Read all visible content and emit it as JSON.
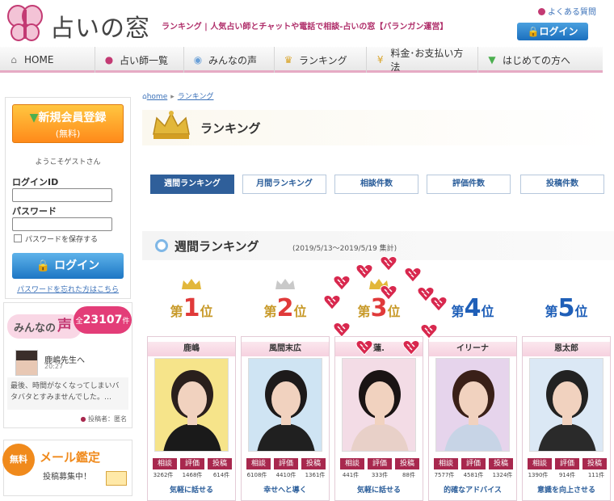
{
  "header": {
    "logo_text": "占いの窓",
    "tagline": "ランキング | 人気占い師とチャットや電話で相談-占いの窓【バランガン運営】",
    "faq": "よくある質問",
    "login": "ログイン"
  },
  "nav": [
    {
      "label": "HOME",
      "icon": "home-icon"
    },
    {
      "label": "占い師一覧",
      "icon": "person-icon"
    },
    {
      "label": "みんなの声",
      "icon": "speech-bubble-icon"
    },
    {
      "label": "ランキング",
      "icon": "crown-icon"
    },
    {
      "label": "料金･お支払い方法",
      "icon": "yen-icon"
    },
    {
      "label": "はじめての方へ",
      "icon": "beginner-mark-icon"
    }
  ],
  "sidebar": {
    "register_l1": "新規会員登録",
    "register_l2": "(無料)",
    "welcome": "ようこそゲストさん",
    "login_id_label": "ログインID",
    "password_label": "パスワード",
    "save_password": "パスワードを保存する",
    "login_button": "ログイン",
    "forgot": "パスワードを忘れた方はこちら",
    "voice": {
      "title": "みんなの",
      "koe": "声",
      "count_prefix": "全",
      "count": "23107",
      "count_unit": "件",
      "who": "鹿嶋先生へ",
      "time": "20:27",
      "text": "最後、時間がなくなってしまいバタバタとすみませんでした。…",
      "poster": "投稿者：匿名"
    },
    "mail": {
      "free": "無料",
      "title": "メール鑑定",
      "sub": "投稿募集中！"
    }
  },
  "breadcrumb": {
    "home": "home",
    "current": "ランキング"
  },
  "page_title": "ランキング",
  "tabs": [
    "週間ランキング",
    "月間ランキング",
    "相談件数",
    "評価件数",
    "投稿件数"
  ],
  "weekly": {
    "title": "週間ランキング",
    "range": "(2019/5/13〜2019/5/19 集計)"
  },
  "badge_labels": [
    "相談",
    "評価",
    "投稿"
  ],
  "ranks": [
    {
      "prefix": "第",
      "num": "1",
      "suffix": "位",
      "color": "#e03a3a",
      "name": "鹿嶋",
      "consult": "3262件",
      "rating": "1468件",
      "posts": "614件",
      "catch": "気軽に話せる",
      "bg": "#f6e48a",
      "hair": "#2a1f1c",
      "cloth": "#1a1a1a"
    },
    {
      "prefix": "第",
      "num": "2",
      "suffix": "位",
      "color": "#e03a3a",
      "name": "風間末広",
      "consult": "6108件",
      "rating": "4410件",
      "posts": "1361件",
      "catch": "幸せへと導く",
      "bg": "#cfe4f3",
      "hair": "#1d1a1a",
      "cloth": "#202020"
    },
    {
      "prefix": "第",
      "num": "3",
      "suffix": "位",
      "color": "#e03a3a",
      "name": "蓮.",
      "consult": "441件",
      "rating": "333件",
      "posts": "88件",
      "catch": "気軽に話せる",
      "bg": "#f3dce6",
      "hair": "#1a1414",
      "cloth": "#e8d0c8"
    },
    {
      "prefix": "第",
      "num": "4",
      "suffix": "位",
      "color": "#1f5fb8",
      "name": "イリーナ",
      "consult": "7577件",
      "rating": "4581件",
      "posts": "1324件",
      "catch": "的確なアドバイス",
      "bg": "#e6d4ec",
      "hair": "#3a2018",
      "cloth": "#c7d4e6"
    },
    {
      "prefix": "第",
      "num": "5",
      "suffix": "位",
      "color": "#1f5fb8",
      "name": "恩太郎",
      "consult": "1390件",
      "rating": "914件",
      "posts": "111件",
      "catch": "意識を向上させる",
      "bg": "#dbe8f5",
      "hair": "#222",
      "cloth": "#2a2a2a"
    }
  ]
}
